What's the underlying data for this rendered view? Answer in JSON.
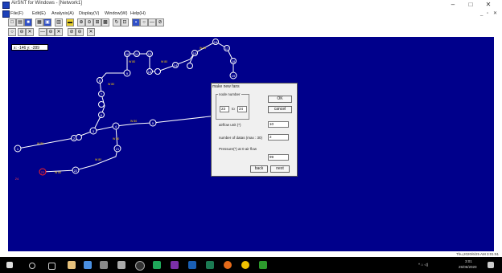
{
  "window": {
    "title": "AirSNT for Windows - [Network1]",
    "controls": [
      "–",
      "□",
      "✕"
    ],
    "mdi_controls": [
      "_",
      "▫",
      "✕"
    ]
  },
  "menu": [
    "File(F)",
    "Edit(E)",
    "Analysis(A)",
    "Display(V)",
    "Window(W)",
    "Help(H)"
  ],
  "canvas": {
    "coord_readout": "x: -146 y: -289",
    "bg_color": "#00008b",
    "node_labels": [
      "1",
      "2",
      "3",
      "4",
      "5",
      "6",
      "7",
      "8",
      "9",
      "10",
      "11",
      "12",
      "13",
      "14",
      "15",
      "16",
      "17",
      "18",
      "19",
      "20",
      "21",
      "22",
      "23",
      "24",
      "25"
    ],
    "edge_label": "W 80"
  },
  "dialog": {
    "title": "make new fans",
    "group_label": "node number",
    "from_value": "23",
    "to_label": "to",
    "to_value": "24",
    "ok_label": "OK",
    "cancel_label": "cancel",
    "airflow_label": "airflow unit (*)",
    "airflow_value": "10",
    "datas_label": "number of datas (max : 30)",
    "datas_value": "2",
    "pressure_label": "Pressure(*) at 0 air flow",
    "pressure_value": "99",
    "back_label": "back",
    "next_label": "next"
  },
  "status": {
    "text": "Thu,2020/6/25 AM 3:01:51"
  },
  "taskbar": {
    "time": "3:01",
    "date": "25/06/2020"
  }
}
